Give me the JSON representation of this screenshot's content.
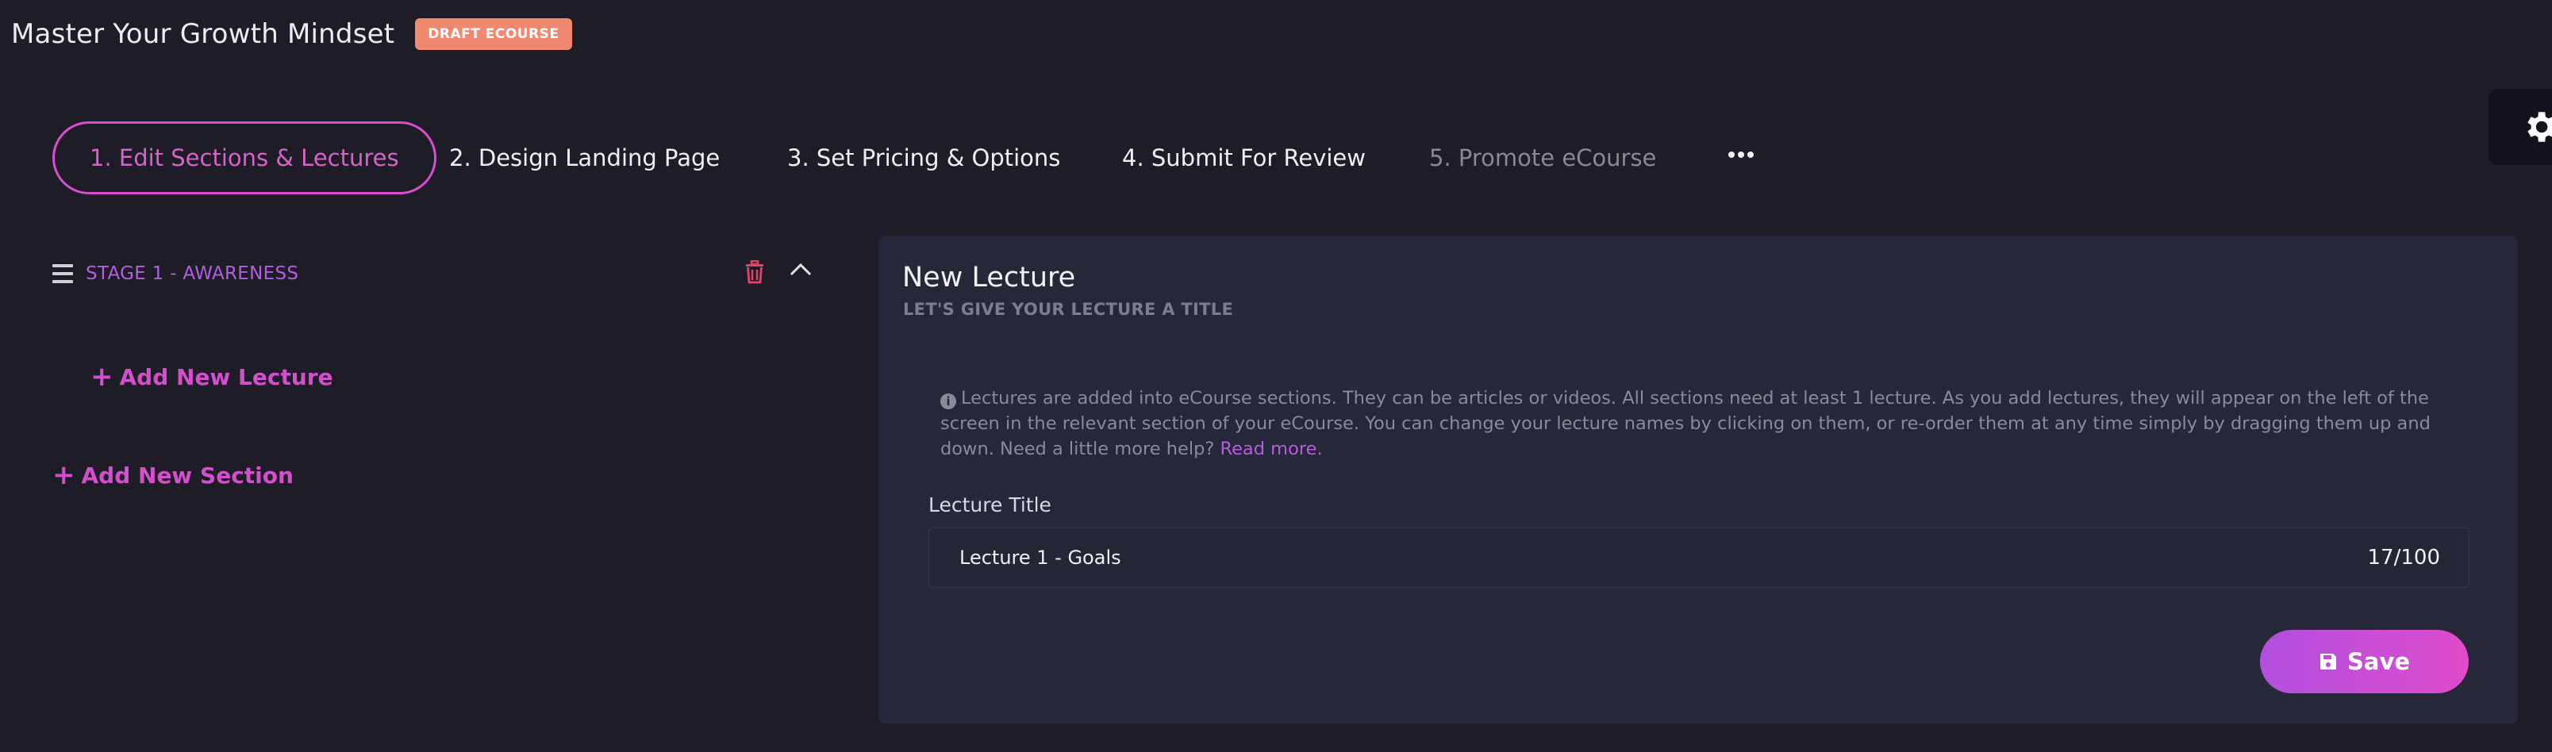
{
  "header": {
    "course_title": "Master Your Growth Mindset",
    "status_badge": "DRAFT ECOURSE"
  },
  "tabs": [
    {
      "label": "1. Edit Sections & Lectures",
      "state": "active"
    },
    {
      "label": "2. Design Landing Page",
      "state": "enabled"
    },
    {
      "label": "3. Set Pricing & Options",
      "state": "enabled"
    },
    {
      "label": "4. Submit For Review",
      "state": "enabled"
    },
    {
      "label": "5. Promote eCourse",
      "state": "disabled"
    }
  ],
  "sidebar": {
    "sections": [
      {
        "name": "STAGE 1 - AWARENESS",
        "expanded": true
      }
    ],
    "add_lecture_label": "Add New Lecture",
    "add_section_label": "Add New Section"
  },
  "panel": {
    "title": "New Lecture",
    "subtitle": "LET'S GIVE YOUR LECTURE A TITLE",
    "info_text": "Lectures are added into eCourse sections. They can be articles or videos. All sections need at least 1 lecture. As you add lectures, they will appear on the left of the screen in the relevant section of your eCourse. You can change your lecture names by clicking on them, or re-order them at any time simply by dragging them up and down. Need a little more help?",
    "read_more_label": "Read more.",
    "field_label": "Lecture Title",
    "field_value": "Lecture 1 - Goals",
    "char_count": "17/100",
    "save_label": "Save"
  },
  "icons": {
    "settings": "gear-icon",
    "more": "ellipsis-icon",
    "drag": "hamburger-icon",
    "delete": "trash-icon",
    "collapse": "chevron-up-icon",
    "add": "plus-icon",
    "info": "info-icon",
    "save": "floppy-disk-icon"
  },
  "colors": {
    "background": "#1d1c27",
    "panel": "#262739",
    "accent": "#d44fcc",
    "accent_purple": "#b55ee0",
    "badge": "#f0896f",
    "delete": "#e0436a"
  }
}
